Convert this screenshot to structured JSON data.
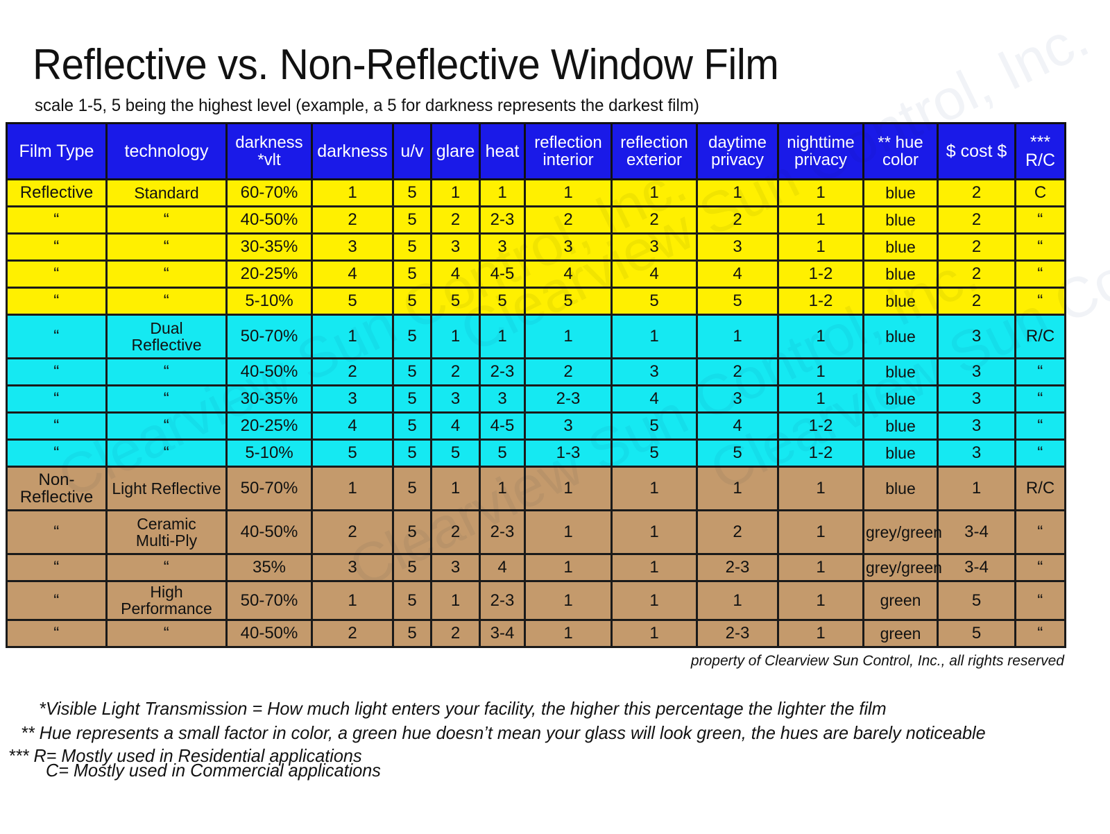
{
  "title": "Reflective vs. Non-Reflective Window Film",
  "subtitle": "scale 1-5, 5 being the highest level (example, a 5 for darkness represents the darkest film)",
  "colors": {
    "header_blue": "#1a1ae8",
    "reflective_yellow": "#fff000",
    "dual_reflective_cyan": "#15e9f2",
    "non_reflective_brown": "#c49a6c",
    "border": "#1a1a1a",
    "text": "#111111"
  },
  "table": {
    "headers": [
      "Film Type",
      "technology",
      "darkness\n*vlt",
      "darkness",
      "u/v",
      "glare",
      "heat",
      "reflection\ninterior",
      "reflection\nexterior",
      "daytime\nprivacy",
      "nighttime\nprivacy",
      "** hue\ncolor",
      "$ cost $",
      "***\nR/C"
    ],
    "header_lines": [
      [
        "Film Type"
      ],
      [
        "technology"
      ],
      [
        "darkness",
        "*vlt"
      ],
      [
        "darkness"
      ],
      [
        "u/v"
      ],
      [
        "glare"
      ],
      [
        "heat"
      ],
      [
        "reflection",
        "interior"
      ],
      [
        "reflection",
        "exterior"
      ],
      [
        "daytime",
        "privacy"
      ],
      [
        "nighttime",
        "privacy"
      ],
      [
        "** hue",
        "color"
      ],
      [
        "$ cost $"
      ],
      [
        "***",
        "R/C"
      ]
    ],
    "rows": [
      {
        "group": "reflective",
        "tall": false,
        "cells": [
          "Reflective",
          "Standard",
          "60-70%",
          "1",
          "5",
          "1",
          "1",
          "1",
          "1",
          "1",
          "1",
          "blue",
          "2",
          "C"
        ]
      },
      {
        "group": "reflective",
        "tall": false,
        "cells": [
          "“",
          "“",
          "40-50%",
          "2",
          "5",
          "2",
          "2-3",
          "2",
          "2",
          "2",
          "1",
          "blue",
          "2",
          "“"
        ]
      },
      {
        "group": "reflective",
        "tall": false,
        "cells": [
          "“",
          "“",
          "30-35%",
          "3",
          "5",
          "3",
          "3",
          "3",
          "3",
          "3",
          "1",
          "blue",
          "2",
          "“"
        ]
      },
      {
        "group": "reflective",
        "tall": false,
        "cells": [
          "“",
          "“",
          "20-25%",
          "4",
          "5",
          "4",
          "4-5",
          "4",
          "4",
          "4",
          "1-2",
          "blue",
          "2",
          "“"
        ]
      },
      {
        "group": "reflective",
        "tall": false,
        "cells": [
          "“",
          "“",
          "5-10%",
          "5",
          "5",
          "5",
          "5",
          "5",
          "5",
          "5",
          "1-2",
          "blue",
          "2",
          "“"
        ]
      },
      {
        "group": "dual",
        "tall": true,
        "cells": [
          "“",
          "Dual\nReflective",
          "50-70%",
          "1",
          "5",
          "1",
          "1",
          "1",
          "1",
          "1",
          "1",
          "blue",
          "3",
          "R/C"
        ]
      },
      {
        "group": "dual",
        "tall": false,
        "cells": [
          "“",
          "“",
          "40-50%",
          "2",
          "5",
          "2",
          "2-3",
          "2",
          "3",
          "2",
          "1",
          "blue",
          "3",
          "“"
        ]
      },
      {
        "group": "dual",
        "tall": false,
        "cells": [
          "“",
          "“",
          "30-35%",
          "3",
          "5",
          "3",
          "3",
          "2-3",
          "4",
          "3",
          "1",
          "blue",
          "3",
          "“"
        ]
      },
      {
        "group": "dual",
        "tall": false,
        "cells": [
          "“",
          "“",
          "20-25%",
          "4",
          "5",
          "4",
          "4-5",
          "3",
          "5",
          "4",
          "1-2",
          "blue",
          "3",
          "“"
        ]
      },
      {
        "group": "dual",
        "tall": false,
        "cells": [
          "“",
          "“",
          "5-10%",
          "5",
          "5",
          "5",
          "5",
          "1-3",
          "5",
          "5",
          "1-2",
          "blue",
          "3",
          "“"
        ]
      },
      {
        "group": "nonreflective",
        "tall": true,
        "cells": [
          "Non-\nReflective",
          "Light Reflective",
          "50-70%",
          "1",
          "5",
          "1",
          "1",
          "1",
          "1",
          "1",
          "1",
          "blue",
          "1",
          "R/C"
        ]
      },
      {
        "group": "nonreflective",
        "tall": true,
        "cells": [
          "“",
          "Ceramic\nMulti-Ply",
          "40-50%",
          "2",
          "5",
          "2",
          "2-3",
          "1",
          "1",
          "2",
          "1",
          "grey/green",
          "3-4",
          "“"
        ]
      },
      {
        "group": "nonreflective",
        "tall": false,
        "cells": [
          "“",
          "“",
          "35%",
          "3",
          "5",
          "3",
          "4",
          "1",
          "1",
          "2-3",
          "1",
          "grey/green",
          "3-4",
          "“"
        ]
      },
      {
        "group": "nonreflective",
        "tall": false,
        "cells": [
          "“",
          "High Performance",
          "50-70%",
          "1",
          "5",
          "1",
          "2-3",
          "1",
          "1",
          "1",
          "1",
          "green",
          "5",
          "“"
        ]
      },
      {
        "group": "nonreflective",
        "tall": false,
        "cells": [
          "“",
          "“",
          "40-50%",
          "2",
          "5",
          "2",
          "3-4",
          "1",
          "1",
          "2-3",
          "1",
          "green",
          "5",
          "“"
        ]
      }
    ]
  },
  "watermark": {
    "text": "Clearview Sun Control, Inc."
  },
  "copyright": "property of Clearview Sun Control, Inc., all rights reserved",
  "notes": {
    "note1": "*Visible Light Transmission = How much light enters your facility, the higher this percentage the lighter the film",
    "note2": "** Hue represents a small factor in color, a green hue doesn’t mean your glass will look green, the hues are barely noticeable",
    "note3": "*** R= Mostly used in Residential applications",
    "note4": "C= Mostly used in Commercial applications"
  }
}
